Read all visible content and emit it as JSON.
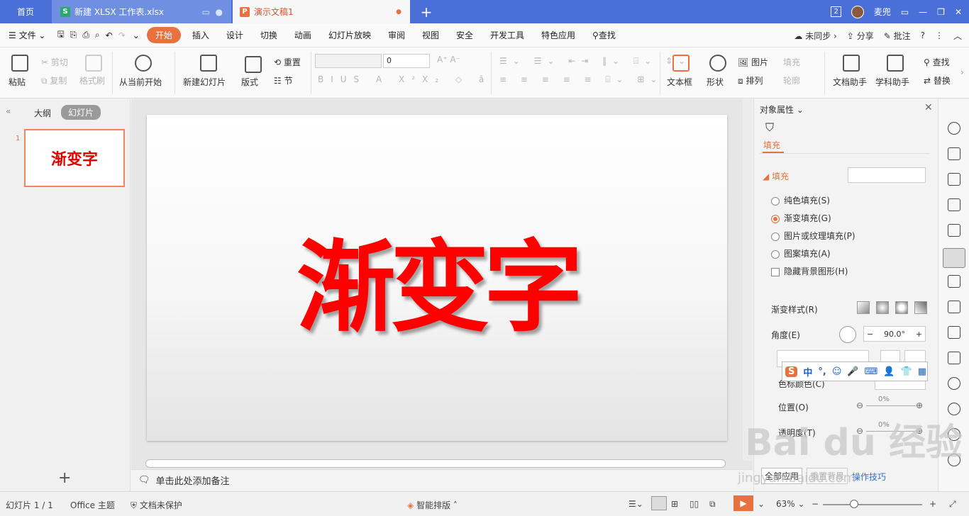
{
  "tabs": {
    "home": "首页",
    "xlsx": "新建 XLSX 工作表.xlsx",
    "ppt": "演示文稿1",
    "badge_count": "2",
    "user": "麦兜"
  },
  "menu": {
    "file": "文件",
    "items": [
      "开始",
      "插入",
      "设计",
      "切换",
      "动画",
      "幻灯片放映",
      "审阅",
      "视图",
      "安全",
      "开发工具",
      "特色应用"
    ],
    "search": "查找",
    "sync": "未同步",
    "share": "分享",
    "comment": "批注"
  },
  "ribbon": {
    "paste": "粘贴",
    "cut": "剪切",
    "copy": "复制",
    "format_painter": "格式刷",
    "from_current": "从当前开始",
    "new_slide": "新建幻灯片",
    "layout": "版式",
    "reset": "重置",
    "section": "节",
    "font_size": "0",
    "textbox": "文本框",
    "shape": "形状",
    "picture": "图片",
    "fill": "填充",
    "arrange": "排列",
    "outline": "轮廓",
    "doc_helper": "文档助手",
    "study_helper": "学科助手",
    "find": "查找",
    "replace": "替换"
  },
  "left": {
    "outline_tab": "大纲",
    "slides_tab": "幻灯片",
    "slide_number": "1",
    "thumb_text": "渐变字"
  },
  "slide": {
    "text": "渐变字",
    "notes_placeholder": "单击此处添加备注"
  },
  "pane": {
    "title": "对象属性",
    "tab_fill": "填充",
    "section_fill": "填充",
    "options": [
      "纯色填充(S)",
      "渐变填充(G)",
      "图片或纹理填充(P)",
      "图案填充(A)"
    ],
    "hide_bg": "隐藏背景图形(H)",
    "grad_style": "渐变样式(R)",
    "angle_label": "角度(E)",
    "angle_value": "90.0°",
    "stop_color": "色标颜色(C)",
    "position": "位置(O)",
    "position_value": "0%",
    "transparency": "透明度(T)",
    "transparency_value": "0%",
    "apply_all": "全部应用",
    "reset_bg": "重置背景",
    "tips": "操作技巧"
  },
  "status": {
    "slide_count": "幻灯片 1 / 1",
    "theme": "Office 主题",
    "protect": "文档未保护",
    "smart_layout": "智能排版",
    "zoom": "63%"
  },
  "ime": {
    "lang": "中"
  },
  "watermark": {
    "main": "Bai du 经验",
    "url": "jingyan.baidu.com"
  },
  "colors": {
    "accent": "#e9703f",
    "tabbar": "#4a6fd6",
    "slide_text": "#ff0000"
  }
}
